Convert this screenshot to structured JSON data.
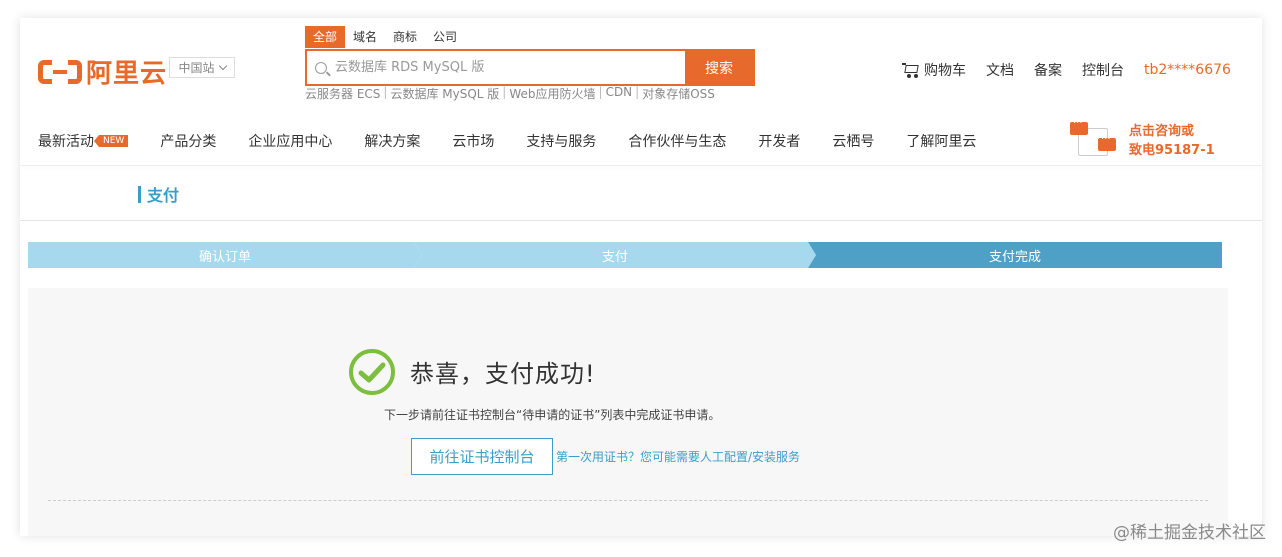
{
  "header": {
    "logo_text": "阿里云",
    "region": "中国站",
    "search": {
      "tabs": [
        "全部",
        "域名",
        "商标",
        "公司"
      ],
      "active_tab": "全部",
      "placeholder": "云数据库 RDS MySQL 版",
      "button": "搜索",
      "hot_links": [
        "云服务器 ECS",
        "云数据库 MySQL 版",
        "Web应用防火墙",
        "CDN",
        "对象存储OSS"
      ]
    },
    "top_links": {
      "cart": "购物车",
      "docs": "文档",
      "beian": "备案",
      "console": "控制台",
      "user": "tb2****6676"
    }
  },
  "nav": {
    "items": [
      "最新活动",
      "产品分类",
      "企业应用中心",
      "解决方案",
      "云市场",
      "支持与服务",
      "合作伙伴与生态",
      "开发者",
      "云栖号",
      "了解阿里云"
    ],
    "new_badge": "NEW",
    "consult_line1": "点击咨询或",
    "consult_line2": "致电95187-1"
  },
  "page": {
    "title": "支付"
  },
  "steps": [
    "确认订单",
    "支付",
    "支付完成"
  ],
  "active_step": 3,
  "success": {
    "title": "恭喜，支付成功!",
    "desc": "下一步请前往证书控制台“待申请的证书”列表中完成证书申请。",
    "button": "前往证书控制台",
    "help_link": "第一次用证书？您可能需要人工配置/安装服务"
  },
  "watermark": "@稀土掘金技术社区",
  "colors": {
    "brand": "#e8692c",
    "link_blue": "#3a9ec8",
    "step_inactive": "#a6d9ee",
    "step_active": "#4ea0c6",
    "success_green": "#7dbd3f"
  }
}
